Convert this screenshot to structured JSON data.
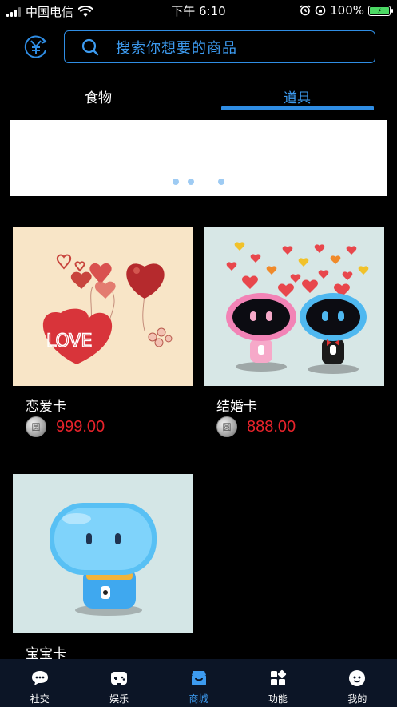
{
  "status_bar": {
    "carrier": "中国电信",
    "time": "下午 6:10",
    "battery": "100%"
  },
  "header": {
    "currency_icon": "yen-exchange-icon",
    "search_placeholder": "搜索你想要的商品"
  },
  "tabs": [
    {
      "label": "食物",
      "active": false
    },
    {
      "label": "道具",
      "active": true
    }
  ],
  "banner": {
    "dots": 3
  },
  "products": [
    {
      "name": "恋爱卡",
      "price": "999.00",
      "image": "hearts-love-balloons"
    },
    {
      "name": "结婚卡",
      "price": "888.00",
      "image": "robot-couple-hearts"
    },
    {
      "name": "宝宝卡",
      "price": "",
      "image": "baby-robot"
    }
  ],
  "coin_glyph": "圆",
  "bottom_nav": [
    {
      "label": "社交",
      "icon": "chat-icon",
      "active": false
    },
    {
      "label": "娱乐",
      "icon": "gamepad-icon",
      "active": false
    },
    {
      "label": "商城",
      "icon": "shop-icon",
      "active": true
    },
    {
      "label": "功能",
      "icon": "grid-icon",
      "active": false
    },
    {
      "label": "我的",
      "icon": "profile-face-icon",
      "active": false
    }
  ],
  "colors": {
    "accent": "#2f8de4",
    "price": "#e8232b",
    "nav_bg": "#0c1526"
  }
}
